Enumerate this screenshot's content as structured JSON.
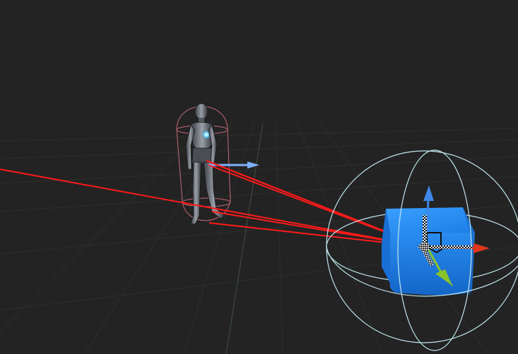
{
  "scene": {
    "background_color": "#232323",
    "grid_color": "#2c2f2c",
    "grid_axis_color": "#3a4a3a",
    "colors": {
      "debug_ray": "#ff1a1a",
      "capsule_collider": "#c46a78",
      "forward_arrow": "#7fb0ff",
      "cube": "#1f7fe6",
      "gizmo_ring": "#bfe6ee",
      "axis_x": "#e0361b",
      "axis_y": "#3f86e6",
      "axis_z": "#8ac22a"
    },
    "objects": [
      {
        "name": "character",
        "icon": "humanoid-character"
      },
      {
        "name": "cube",
        "icon": "cube"
      }
    ]
  }
}
